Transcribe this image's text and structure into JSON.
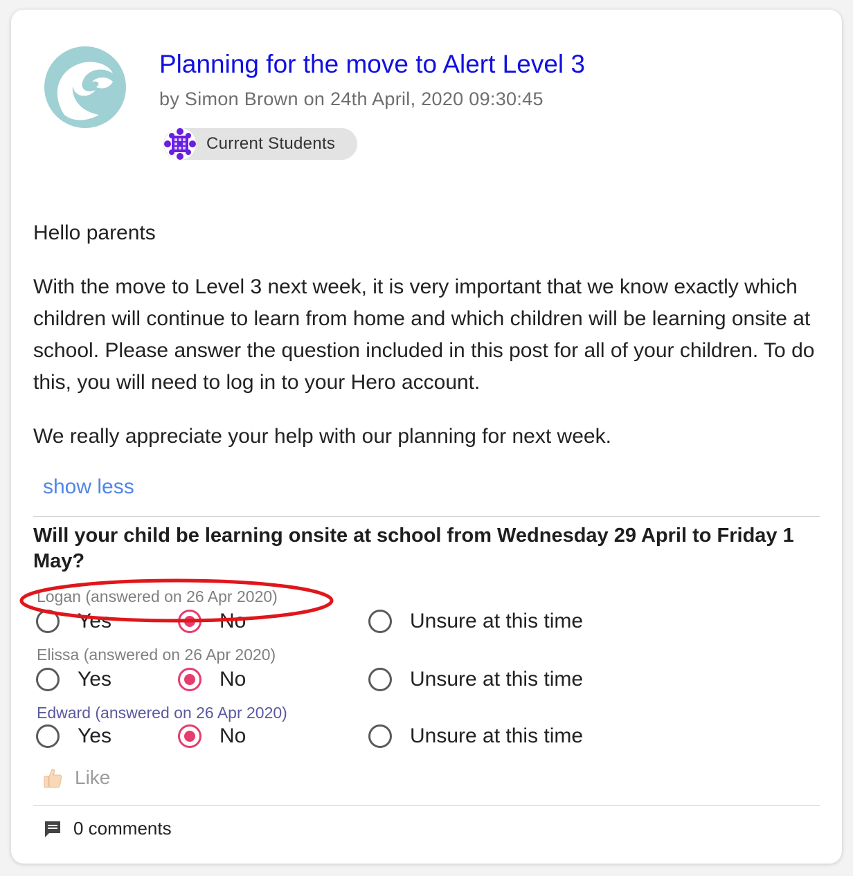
{
  "post": {
    "title": "Planning for the move to Alert Level 3",
    "byline": "by Simon Brown on 24th April, 2020 09:30:45",
    "tag_label": "Current Students",
    "logo_icon": "school-logo-icon",
    "tag_icon": "group-pattern-icon"
  },
  "body": {
    "greeting": "Hello parents",
    "paragraph1": "With the move to Level 3 next week, it is very important that we know exactly which children will continue to learn from home and which children will be learning onsite at school. Please answer the question included in this post for all of your children. To do this, you will need to log in to your Hero account.",
    "paragraph2": "We really appreciate your help with our planning for next week."
  },
  "show_less_label": "show less",
  "question": {
    "text": "Will your child be learning onsite at school from Wednesday 29 April to Friday 1 May?",
    "options": [
      "Yes",
      "No",
      "Unsure at this time"
    ],
    "children": [
      {
        "label": "Logan (answered on 26 Apr 2020)",
        "selected": "No"
      },
      {
        "label": "Elissa (answered on 26 Apr 2020)",
        "selected": "No"
      },
      {
        "label": "Edward (answered on 26 Apr 2020)",
        "selected": "No"
      }
    ]
  },
  "footer": {
    "like_label": "Like",
    "like_icon": "thumbs-up-icon",
    "comments_label": "0 comments",
    "comments_icon": "comment-icon"
  },
  "colors": {
    "title": "#1010e0",
    "link": "#4f86e8",
    "radio_selected": "#e73c6e",
    "annotation": "#e0161b",
    "tag_bg": "#e3e3e3"
  }
}
